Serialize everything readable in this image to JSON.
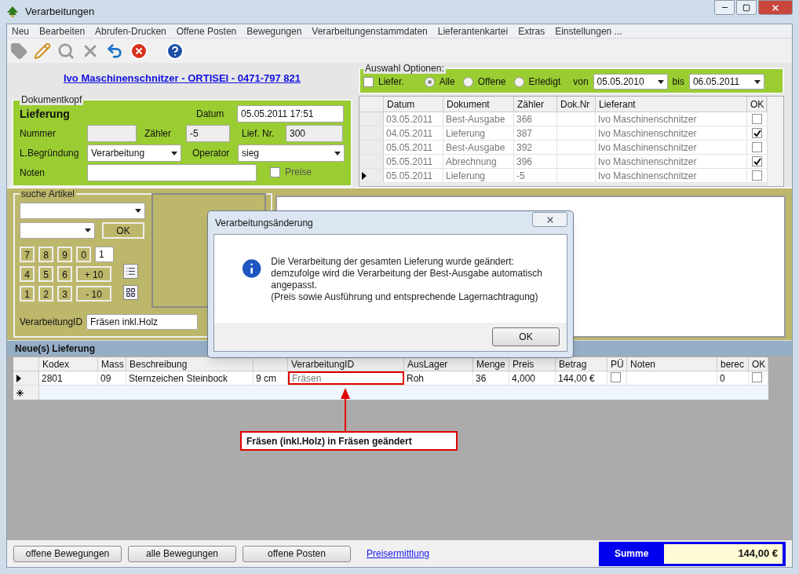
{
  "window": {
    "title": "Verarbeitungen"
  },
  "menu": [
    "Neu",
    "Bearbeiten",
    "Abrufen-Drucken",
    "Offene Posten",
    "Bewegungen",
    "Verarbeitungenstammdaten",
    "Lieferantenkartei",
    "Extras",
    "Einstellungen ..."
  ],
  "toolbar": [
    {
      "kind": "tag",
      "disabled": true
    },
    {
      "kind": "edit",
      "disabled": false
    },
    {
      "kind": "search",
      "disabled": true
    },
    {
      "kind": "delete",
      "disabled": true
    },
    {
      "kind": "undo",
      "disabled": false
    },
    {
      "kind": "cancel",
      "disabled": false
    },
    {
      "kind": "help",
      "disabled": false
    }
  ],
  "customer_link": "Ivo Maschinenschnitzer - ORTISEI - 0471-797 821",
  "dokumentkopf": {
    "legend": "Dokumentkopf",
    "doc_type": "Lieferung",
    "datum": {
      "label": "Datum",
      "value": "05.05.2011 17:51"
    },
    "nummer": {
      "label": "Nummer"
    },
    "zaehler": {
      "label": "Zähler",
      "value": "-5"
    },
    "lief_nr": {
      "label": "Lief. Nr.",
      "value": "300"
    },
    "begruendung": {
      "label": "L.Begründung",
      "value": "Verarbeitung"
    },
    "operator": {
      "label": "Operator",
      "value": "sieg"
    },
    "noten": {
      "label": "Noten"
    },
    "preise": {
      "label": "Preise",
      "checked": false
    }
  },
  "auswahl": {
    "legend": "Auswahl Optionen:",
    "liefer": {
      "label": "Liefer.",
      "checked": false
    },
    "radios": [
      {
        "label": "Alle",
        "selected": true
      },
      {
        "label": "Offene",
        "selected": false
      },
      {
        "label": "Erledigt",
        "selected": false
      }
    ],
    "von": {
      "label": "von",
      "value": "05.05.2010"
    },
    "bis": {
      "label": "bis",
      "value": "06.05.2011"
    }
  },
  "documents": {
    "columns": [
      "Datum",
      "Dokument",
      "Zähler",
      "Dok.Nr",
      "Lieferant",
      "OK"
    ],
    "rows": [
      {
        "datum": "03.05.2011",
        "dokument": "Best-Ausgabe",
        "zaehler": "366",
        "lieferant": "Ivo Maschinenschnitzer",
        "ok": false,
        "selected": false
      },
      {
        "datum": "04.05.2011",
        "dokument": "Lieferung",
        "zaehler": "387",
        "lieferant": "Ivo Maschinenschnitzer",
        "ok": true,
        "selected": false
      },
      {
        "datum": "05.05.2011",
        "dokument": "Best-Ausgabe",
        "zaehler": "392",
        "lieferant": "Ivo Maschinenschnitzer",
        "ok": false,
        "selected": false
      },
      {
        "datum": "05.05.2011",
        "dokument": "Abrechnung",
        "zaehler": "396",
        "lieferant": "Ivo Maschinenschnitzer",
        "ok": true,
        "selected": false
      },
      {
        "datum": "05.05.2011",
        "dokument": "Lieferung",
        "zaehler": "-5",
        "lieferant": "Ivo Maschinenschnitzer",
        "ok": false,
        "selected": true
      }
    ]
  },
  "suche": {
    "legend": "suche Artikel",
    "ok_button": "OK",
    "quantity": "1",
    "keys": [
      [
        "7",
        "8",
        "9",
        "0"
      ],
      [
        "4",
        "5",
        "6",
        "+ 10"
      ],
      [
        "1",
        "2",
        "3",
        "- 10"
      ]
    ],
    "verarbeitung": {
      "label": "VerarbeitungID",
      "value": "Fräsen inkl.Holz"
    }
  },
  "lieferung": {
    "title": "Neue(s) Lieferung",
    "columns": [
      {
        "label": "Kodex"
      },
      {
        "label": "Mass"
      },
      {
        "label": "Beschreibung"
      },
      {},
      {
        "label": "VerarbeitungID"
      },
      {
        "label": "AusLager"
      },
      {
        "label": "Menge"
      },
      {
        "label": "Preis"
      },
      {
        "label": "Betrag"
      },
      {
        "label": "PÜ"
      },
      {
        "label": "Noten"
      },
      {
        "label": "berec"
      },
      {
        "label": "OK"
      }
    ],
    "rows": [
      {
        "selected": true,
        "cells": [
          {
            "kind": "text",
            "text": "2801",
            "marked": false
          },
          {
            "kind": "text",
            "text": "09",
            "marked": false
          },
          {
            "kind": "text",
            "text": "Sternzeichen Steinbock",
            "marked": false
          },
          {
            "kind": "text",
            "text": "9 cm",
            "marked": false
          },
          {
            "kind": "text",
            "text": "Fräsen",
            "marked": true
          },
          {
            "kind": "text",
            "text": "Roh",
            "marked": false
          },
          {
            "kind": "text",
            "text": "36",
            "marked": false
          },
          {
            "kind": "text",
            "text": "4,000",
            "marked": false
          },
          {
            "kind": "text",
            "text": "144,00 €",
            "marked": false
          },
          {
            "kind": "check",
            "checked": false
          },
          {
            "kind": "blank"
          },
          {
            "kind": "text",
            "text": "0",
            "marked": false
          },
          {
            "kind": "check",
            "checked": false
          }
        ]
      }
    ]
  },
  "annotation": "Fräsen (inkl.Holz) in Fräsen geändert",
  "dialog": {
    "title": "Verarbeitungsänderung",
    "message": [
      "Die Verarbeitung der gesamten Lieferung wurde geändert:",
      "demzufolge wird die Verarbeitung der Best-Ausgabe automatisch angepasst.",
      "(Preis sowie Ausführung und entsprechende Lagernachtragung)"
    ],
    "button": "OK"
  },
  "bottom": {
    "buttons": [
      "offene Bewegungen",
      "alle Bewegungen",
      "offene Posten"
    ],
    "link": "Preisermittlung",
    "summe": {
      "label": "Summe",
      "value": "144,00 €"
    }
  }
}
